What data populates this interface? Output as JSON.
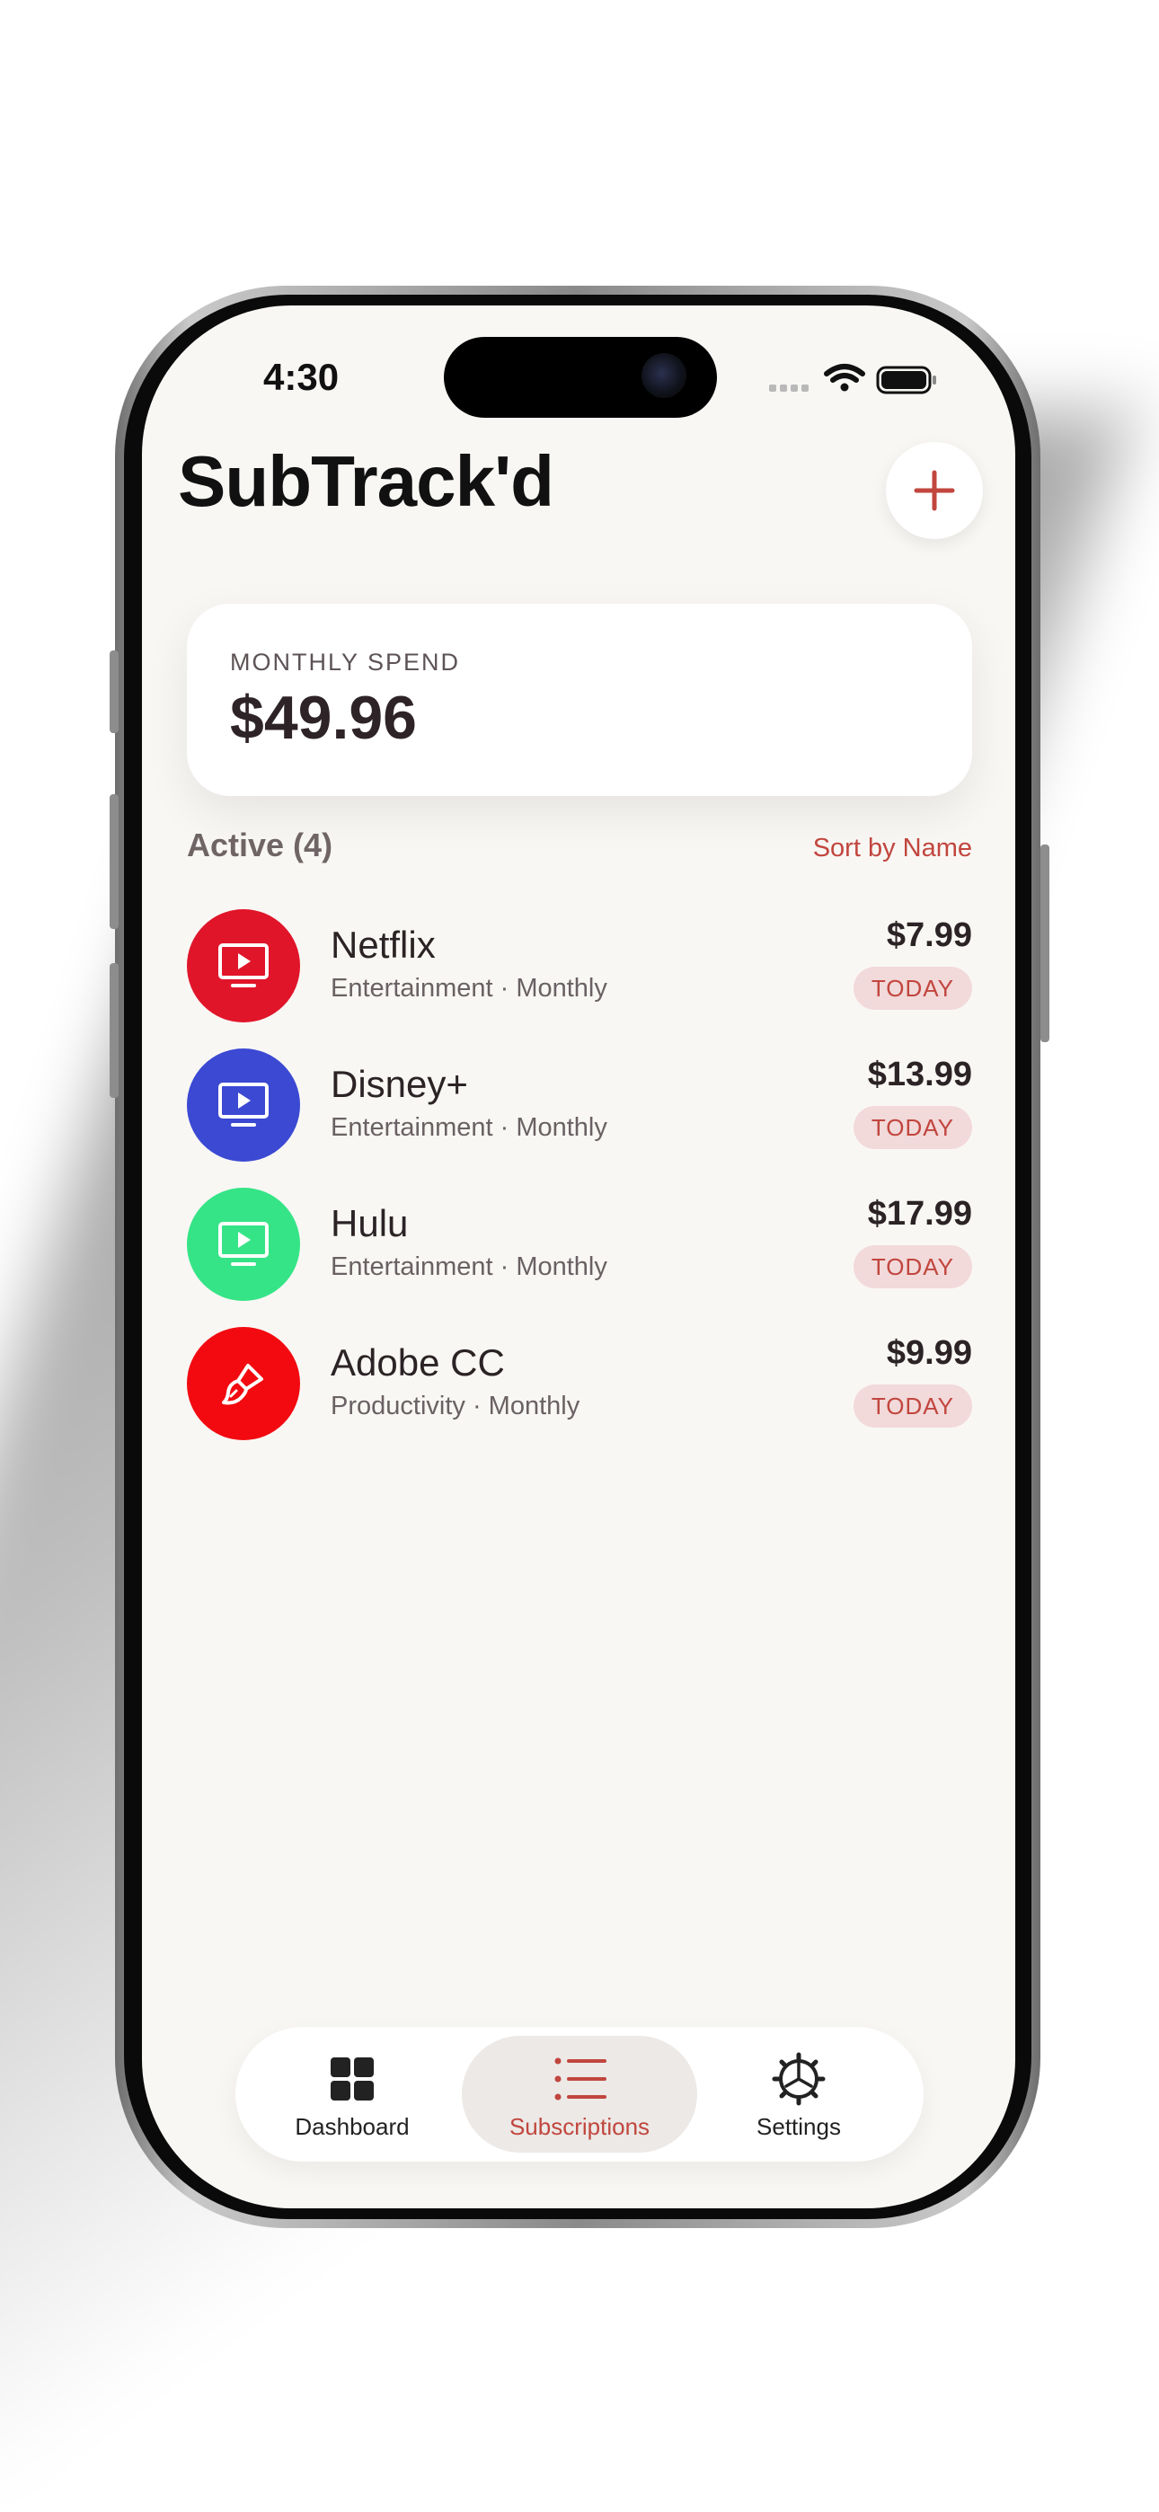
{
  "status_bar": {
    "time": "4:30"
  },
  "app": {
    "title": "SubTrack'd",
    "add_icon": "plus-icon"
  },
  "summary": {
    "label": "MONTHLY SPEND",
    "value": "$49.96"
  },
  "list_header": {
    "active_label": "Active (4)",
    "sort_label": "Sort by Name"
  },
  "subscriptions": [
    {
      "name": "Netflix",
      "meta": "Entertainment · Monthly",
      "price": "$7.99",
      "badge": "TODAY",
      "color": "#e0152a",
      "icon": "tv-play-icon"
    },
    {
      "name": "Disney+",
      "meta": "Entertainment · Monthly",
      "price": "$13.99",
      "badge": "TODAY",
      "color": "#3b49d3",
      "icon": "tv-play-icon"
    },
    {
      "name": "Hulu",
      "meta": "Entertainment · Monthly",
      "price": "$17.99",
      "badge": "TODAY",
      "color": "#35e486",
      "icon": "tv-play-icon"
    },
    {
      "name": "Adobe CC",
      "meta": "Productivity · Monthly",
      "price": "$9.99",
      "badge": "TODAY",
      "color": "#f20a10",
      "icon": "paintbrush-icon"
    }
  ],
  "tabs": [
    {
      "label": "Dashboard",
      "icon": "grid-icon",
      "active": false
    },
    {
      "label": "Subscriptions",
      "icon": "list-icon",
      "active": true
    },
    {
      "label": "Settings",
      "icon": "gear-icon",
      "active": false
    }
  ],
  "colors": {
    "accent": "#c1463e",
    "background": "#f9f7f4"
  }
}
